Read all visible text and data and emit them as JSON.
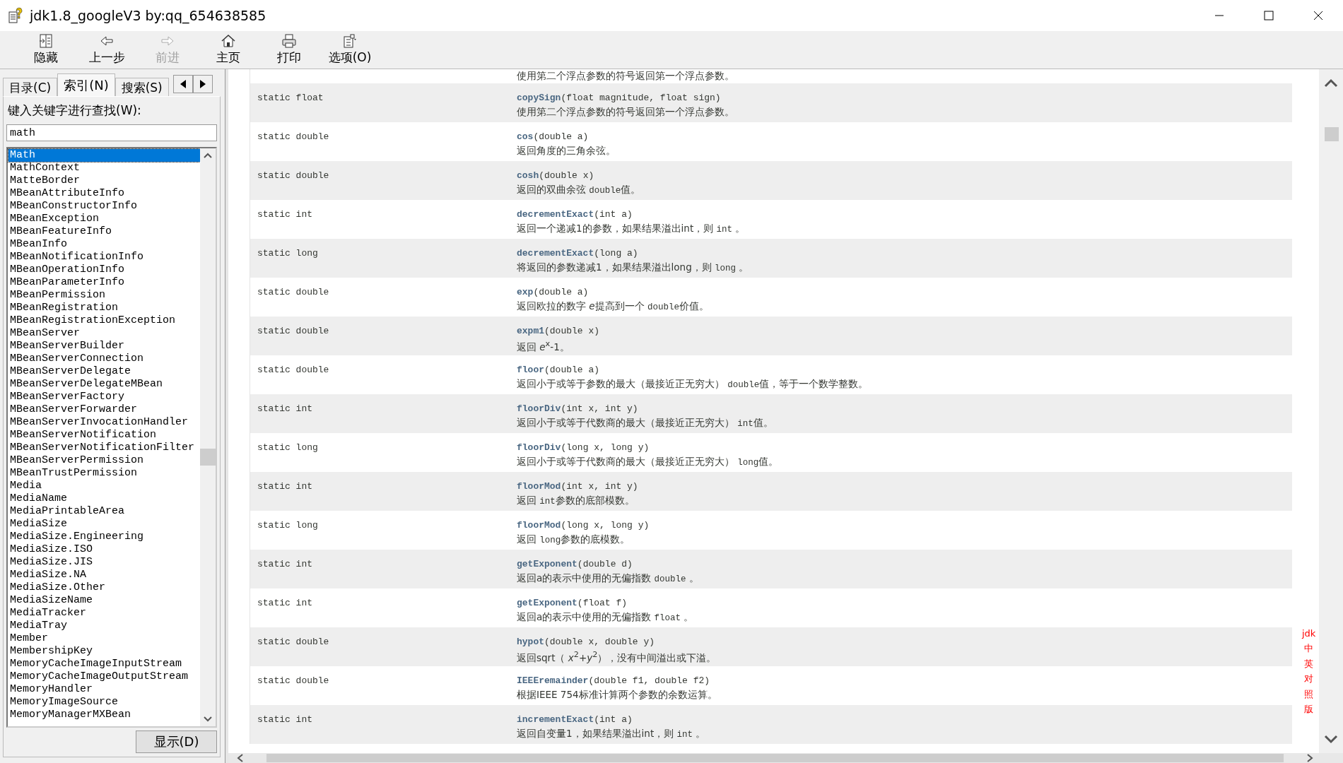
{
  "window": {
    "title": "jdk1.8_googleV3 by:qq_654638585"
  },
  "toolbar": [
    {
      "kind": "hide",
      "label": "隐藏",
      "disabled": false
    },
    {
      "kind": "back",
      "label": "上一步",
      "disabled": false
    },
    {
      "kind": "forward",
      "label": "前进",
      "disabled": true
    },
    {
      "kind": "home",
      "label": "主页",
      "disabled": false
    },
    {
      "kind": "print",
      "label": "打印",
      "disabled": false
    },
    {
      "kind": "options",
      "label": "选项(O)",
      "disabled": false
    }
  ],
  "tabs": [
    {
      "label": "目录(C)",
      "selected": false
    },
    {
      "label": "索引(N)",
      "selected": true
    },
    {
      "label": "搜索(S)",
      "selected": false
    }
  ],
  "keyword_label": "键入关键字进行查找(W):",
  "keyword_field": {
    "value": "math"
  },
  "index_list": [
    {
      "label": "Math",
      "selected": true
    },
    {
      "label": "MathContext",
      "selected": false
    },
    {
      "label": "MatteBorder",
      "selected": false
    },
    {
      "label": "MBeanAttributeInfo",
      "selected": false
    },
    {
      "label": "MBeanConstructorInfo",
      "selected": false
    },
    {
      "label": "MBeanException",
      "selected": false
    },
    {
      "label": "MBeanFeatureInfo",
      "selected": false
    },
    {
      "label": "MBeanInfo",
      "selected": false
    },
    {
      "label": "MBeanNotificationInfo",
      "selected": false
    },
    {
      "label": "MBeanOperationInfo",
      "selected": false
    },
    {
      "label": "MBeanParameterInfo",
      "selected": false
    },
    {
      "label": "MBeanPermission",
      "selected": false
    },
    {
      "label": "MBeanRegistration",
      "selected": false
    },
    {
      "label": "MBeanRegistrationException",
      "selected": false
    },
    {
      "label": "MBeanServer",
      "selected": false
    },
    {
      "label": "MBeanServerBuilder",
      "selected": false
    },
    {
      "label": "MBeanServerConnection",
      "selected": false
    },
    {
      "label": "MBeanServerDelegate",
      "selected": false
    },
    {
      "label": "MBeanServerDelegateMBean",
      "selected": false
    },
    {
      "label": "MBeanServerFactory",
      "selected": false
    },
    {
      "label": "MBeanServerForwarder",
      "selected": false
    },
    {
      "label": "MBeanServerInvocationHandler",
      "selected": false
    },
    {
      "label": "MBeanServerNotification",
      "selected": false
    },
    {
      "label": "MBeanServerNotificationFilter",
      "selected": false
    },
    {
      "label": "MBeanServerPermission",
      "selected": false
    },
    {
      "label": "MBeanTrustPermission",
      "selected": false
    },
    {
      "label": "Media",
      "selected": false
    },
    {
      "label": "MediaName",
      "selected": false
    },
    {
      "label": "MediaPrintableArea",
      "selected": false
    },
    {
      "label": "MediaSize",
      "selected": false
    },
    {
      "label": "MediaSize.Engineering",
      "selected": false
    },
    {
      "label": "MediaSize.ISO",
      "selected": false
    },
    {
      "label": "MediaSize.JIS",
      "selected": false
    },
    {
      "label": "MediaSize.NA",
      "selected": false
    },
    {
      "label": "MediaSize.Other",
      "selected": false
    },
    {
      "label": "MediaSizeName",
      "selected": false
    },
    {
      "label": "MediaTracker",
      "selected": false
    },
    {
      "label": "MediaTray",
      "selected": false
    },
    {
      "label": "Member",
      "selected": false
    },
    {
      "label": "MembershipKey",
      "selected": false
    },
    {
      "label": "MemoryCacheImageInputStream",
      "selected": false
    },
    {
      "label": "MemoryCacheImageOutputStream",
      "selected": false
    },
    {
      "label": "MemoryHandler",
      "selected": false
    },
    {
      "label": "MemoryImageSource",
      "selected": false
    },
    {
      "label": "MemoryManagerMXBean",
      "selected": false
    }
  ],
  "display_button": "显示(D)",
  "partial_description": "使用第二个浮点参数的符号返回第一个浮点参数。",
  "methods": [
    {
      "modifier": "static float",
      "method": "copySign",
      "params": "(float magnitude, float sign)",
      "description": [
        {
          "kind": "text",
          "text": "使用第二个浮点参数的符号返回第一个浮点参数。"
        }
      ]
    },
    {
      "modifier": "static double",
      "method": "cos",
      "params": "(double a)",
      "description": [
        {
          "kind": "text",
          "text": "返回角度的三角余弦。"
        }
      ]
    },
    {
      "modifier": "static double",
      "method": "cosh",
      "params": "(double x)",
      "description": [
        {
          "kind": "text",
          "text": "返回的双曲余弦 "
        },
        {
          "kind": "code",
          "text": "double"
        },
        {
          "kind": "text",
          "text": "值。"
        }
      ]
    },
    {
      "modifier": "static int",
      "method": "decrementExact",
      "params": "(int a)",
      "description": [
        {
          "kind": "text",
          "text": "返回一个递减1的参数，如果结果溢出int，则 "
        },
        {
          "kind": "code",
          "text": "int"
        },
        {
          "kind": "text",
          "text": " 。"
        }
      ]
    },
    {
      "modifier": "static long",
      "method": "decrementExact",
      "params": "(long a)",
      "description": [
        {
          "kind": "text",
          "text": "将返回的参数递减1，如果结果溢出long，则 "
        },
        {
          "kind": "code",
          "text": "long"
        },
        {
          "kind": "text",
          "text": " 。"
        }
      ]
    },
    {
      "modifier": "static double",
      "method": "exp",
      "params": "(double a)",
      "description": [
        {
          "kind": "text",
          "text": "返回欧拉的数字 "
        },
        {
          "kind": "math",
          "text": "e"
        },
        {
          "kind": "text",
          "text": "提高到一个 "
        },
        {
          "kind": "code",
          "text": "double"
        },
        {
          "kind": "text",
          "text": "价值。"
        }
      ]
    },
    {
      "modifier": "static double",
      "method": "expm1",
      "params": "(double x)",
      "description": [
        {
          "kind": "text",
          "text": "返回 *e*$^{x}$-1。"
        }
      ]
    },
    {
      "modifier": "static double",
      "method": "floor",
      "params": "(double a)",
      "description": [
        {
          "kind": "text",
          "text": "返回小于或等于参数的最大（最接近正无穷大） "
        },
        {
          "kind": "code",
          "text": "double"
        },
        {
          "kind": "text",
          "text": "值，等于一个数学整数。"
        }
      ]
    },
    {
      "modifier": "static int",
      "method": "floorDiv",
      "params": "(int x, int y)",
      "description": [
        {
          "kind": "text",
          "text": "返回小于或等于代数商的最大（最接近正无穷大） "
        },
        {
          "kind": "code",
          "text": "int"
        },
        {
          "kind": "text",
          "text": "值。"
        }
      ]
    },
    {
      "modifier": "static long",
      "method": "floorDiv",
      "params": "(long x, long y)",
      "description": [
        {
          "kind": "text",
          "text": "返回小于或等于代数商的最大（最接近正无穷大） "
        },
        {
          "kind": "code",
          "text": "long"
        },
        {
          "kind": "text",
          "text": "值。"
        }
      ]
    },
    {
      "modifier": "static int",
      "method": "floorMod",
      "params": "(int x, int y)",
      "description": [
        {
          "kind": "text",
          "text": "返回 "
        },
        {
          "kind": "code",
          "text": "int"
        },
        {
          "kind": "text",
          "text": "参数的底部模数。"
        }
      ]
    },
    {
      "modifier": "static long",
      "method": "floorMod",
      "params": "(long x, long y)",
      "description": [
        {
          "kind": "text",
          "text": "返回 "
        },
        {
          "kind": "code",
          "text": "long"
        },
        {
          "kind": "text",
          "text": "参数的底模数。"
        }
      ]
    },
    {
      "modifier": "static int",
      "method": "getExponent",
      "params": "(double d)",
      "description": [
        {
          "kind": "text",
          "text": "返回a的表示中使用的无偏指数 "
        },
        {
          "kind": "code",
          "text": "double"
        },
        {
          "kind": "text",
          "text": " 。"
        }
      ]
    },
    {
      "modifier": "static int",
      "method": "getExponent",
      "params": "(float f)",
      "description": [
        {
          "kind": "text",
          "text": "返回a的表示中使用的无偏指数 "
        },
        {
          "kind": "code",
          "text": "float"
        },
        {
          "kind": "text",
          "text": " 。"
        }
      ]
    },
    {
      "modifier": "static double",
      "method": "hypot",
      "params": "(double x, double y)",
      "description": [
        {
          "kind": "text",
          "text": "返回sqrt（ *x*$^{2}$+*y*$^{2}$），没有中间溢出或下溢。"
        }
      ]
    },
    {
      "modifier": "static double",
      "method": "IEEEremainder",
      "params": "(double f1, double f2)",
      "description": [
        {
          "kind": "text",
          "text": "根据IEEE 754标准计算两个参数的余数运算。"
        }
      ]
    },
    {
      "modifier": "static int",
      "method": "incrementExact",
      "params": "(int a)",
      "description": [
        {
          "kind": "text",
          "text": "返回自变量1，如果结果溢出int，则 "
        },
        {
          "kind": "code",
          "text": "int"
        },
        {
          "kind": "text",
          "text": " 。"
        }
      ]
    }
  ],
  "side_label": "jdk中英对照版"
}
